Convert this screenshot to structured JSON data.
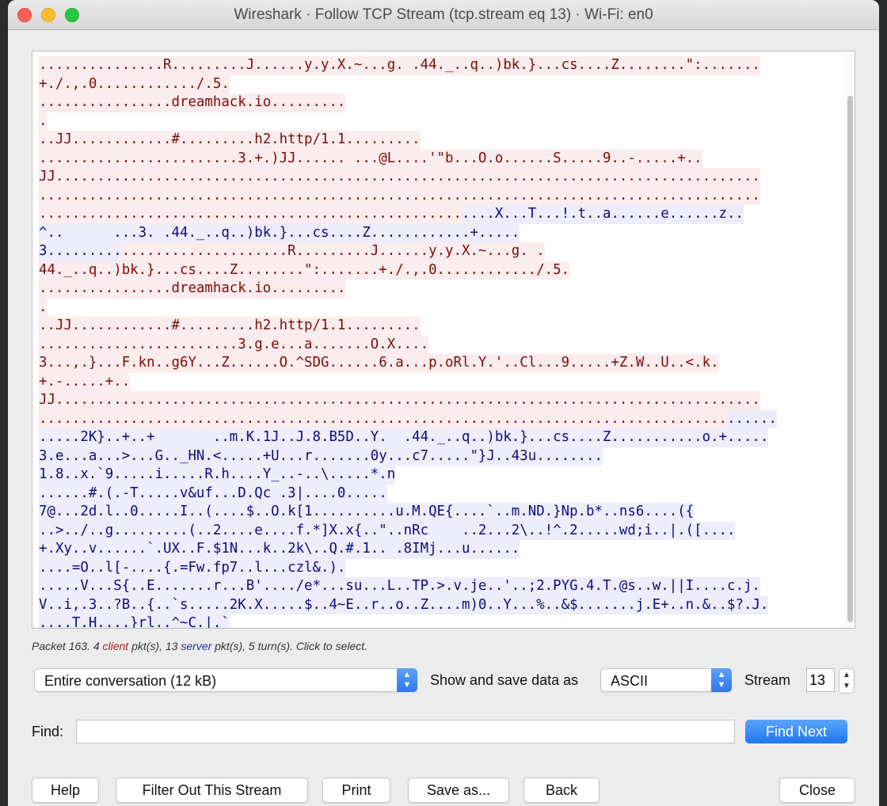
{
  "window": {
    "title": "Wireshark · Follow TCP Stream (tcp.stream eq 13) · Wi-Fi: en0"
  },
  "stream_lines": [
    [
      {
        "t": "...............R.........J......y.y.X.~...g. .44._..q..)bk.}...cs....Z........\":.......",
        "k": "c"
      }
    ],
    [
      {
        "t": "+./.,.0............/.5.",
        "k": "c"
      }
    ],
    [
      {
        "t": "................dreamhack.io.........",
        "k": "c"
      }
    ],
    [
      {
        "t": ".",
        "k": "c"
      }
    ],
    [
      {
        "t": "..JJ............#.........h2.http/1.1.........",
        "k": "c"
      }
    ],
    [
      {
        "t": "........................3.+.)JJ...... ...@L....'\"b...O.o......S.....9..-.....+..",
        "k": "c"
      }
    ],
    [
      {
        "t": "JJ.....................................................................................",
        "k": "c"
      }
    ],
    [
      {
        "t": ".......................................................................................",
        "k": "c"
      }
    ],
    [
      {
        "t": "...................................................",
        "k": "c"
      },
      {
        "t": "....X...T...!.t..a......e......z..",
        "k": "s"
      }
    ],
    [
      {
        "t": "^..      ...3. .44._..q..)bk.}...cs....Z............+.....",
        "k": "s"
      }
    ],
    [
      {
        "t": "3.........",
        "k": "s"
      },
      {
        "t": "....................R.........J......y.y.X.~...g. .",
        "k": "c"
      }
    ],
    [
      {
        "t": "44._..q..)bk.}...cs....Z........\":.......+./.,.0............/.5.",
        "k": "c"
      }
    ],
    [
      {
        "t": "................dreamhack.io.........",
        "k": "c"
      }
    ],
    [
      {
        "t": ".",
        "k": "c"
      }
    ],
    [
      {
        "t": "..JJ............#.........h2.http/1.1.........",
        "k": "c"
      }
    ],
    [
      {
        "t": "........................3.g.e...a.......O.X....",
        "k": "c"
      }
    ],
    [
      {
        "t": "3...,.}...F.kn..g6Y...Z......O.^SDG......6.a...p.oRl.Y.'..Cl...9.....+Z.W..U..<.k.",
        "k": "c"
      }
    ],
    [
      {
        "t": "+.-.....+..",
        "k": "c"
      }
    ],
    [
      {
        "t": "JJ.....................................................................................",
        "k": "c"
      }
    ],
    [
      {
        "t": "...................................................................................",
        "k": "c"
      },
      {
        "t": "......",
        "k": "s"
      }
    ],
    [
      {
        "t": ".....2K}..+..+       ..m.K.1J..J.8.B5D..Y.  .44._..q..)bk.}...cs....Z...........o.+.....",
        "k": "s"
      }
    ],
    [
      {
        "t": "3.e...a...>...G.._HN.<.....+U...r.......0y...c7.....\"}J..43u........",
        "k": "s"
      }
    ],
    [
      {
        "t": "1.8..x.`9.....i.....R.h....Y_..-..\\.....*.n",
        "k": "s"
      }
    ],
    [
      {
        "t": "......#.(.-T.....v&uf...D.Qc .3|....0.....",
        "k": "s"
      }
    ],
    [
      {
        "t": "7@...2d.l..0.....I..(....$..O.k[1..........u.M.QE{....`..m.ND.}Np.b*..ns6....({",
        "k": "s"
      }
    ],
    [
      {
        "t": "..>../..g.........(..2....e....f.*]X.x{..\"..nRc    ..2...2\\..!^.2.....wd;i..|.([....",
        "k": "s"
      }
    ],
    [
      {
        "t": "+.Xy..v......`.UX..F.$1N...k..2k\\..Q.#.1.. .8IMj...u......",
        "k": "s"
      }
    ],
    [
      {
        "t": "....=O..l[-....{.=Fw.fp7..l...czl&.).",
        "k": "s"
      }
    ],
    [
      {
        "t": ".....V...S{..E.......r...B'..../e*...su...L..TP.>.v.je..'..;2.PYG.4.T.@s..w.||I....c.j.",
        "k": "s"
      }
    ],
    [
      {
        "t": "V..i,.3..?B..{..`s.....2K.X.....$..4~E..r..o..Z....m)0..Y...%..&$.......j.E+..n.&..$?.J.",
        "k": "s"
      }
    ],
    [
      {
        "t": "....T.H....}rl..^~C.|.`",
        "k": "s"
      }
    ]
  ],
  "status": {
    "prefix": "Packet 163. 4 ",
    "client": "client",
    "middle": " pkt(s), 13 ",
    "server": "server",
    "suffix": " pkt(s), 5 turn(s). Click to select."
  },
  "conversation_select": {
    "value": "Entire conversation (12 kB)"
  },
  "show_as_label": "Show and save data as",
  "format_select": {
    "value": "ASCII"
  },
  "stream_label": "Stream",
  "stream_value": "13",
  "find": {
    "label": "Find:",
    "value": "",
    "button": "Find Next"
  },
  "buttons": {
    "help": "Help",
    "filter_out": "Filter Out This Stream",
    "print": "Print",
    "save_as": "Save as...",
    "back": "Back",
    "close": "Close"
  },
  "colors": {
    "client_bg": "#fbeded",
    "client_fg": "#7d0b0b",
    "server_bg": "#ededfb",
    "server_fg": "#0d0d80",
    "accent": "#1e76ee"
  }
}
